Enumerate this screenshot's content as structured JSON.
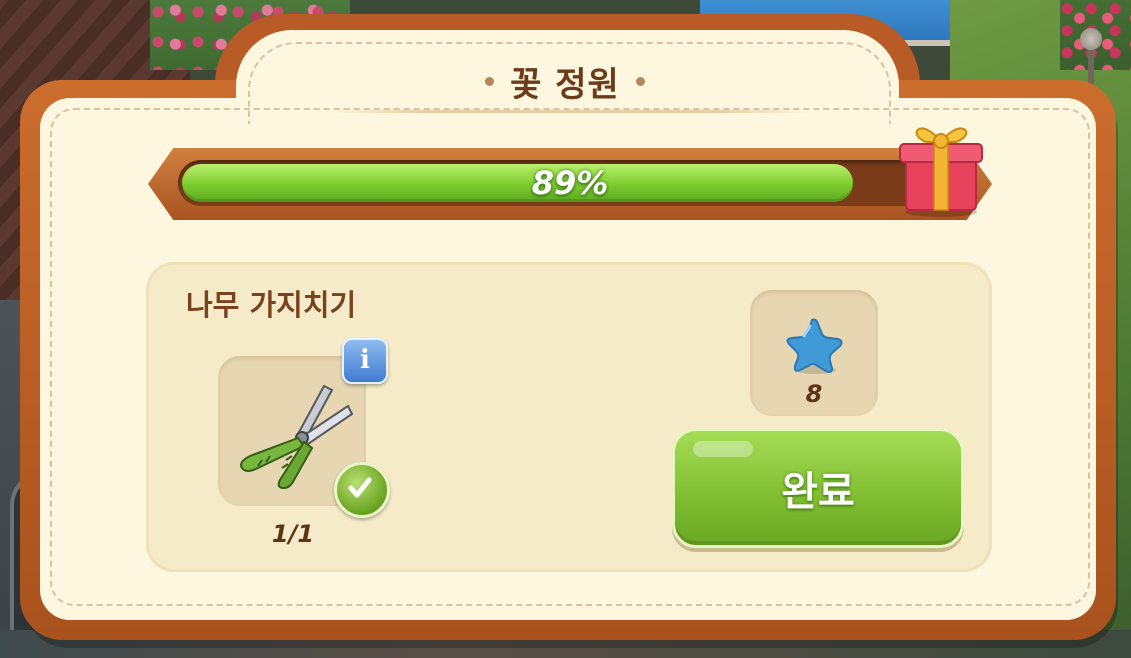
{
  "popup": {
    "title": "꽃 정원"
  },
  "progress": {
    "label": "89%",
    "value": 0.89,
    "fill_color": "#7ccc2e",
    "reward_icon": "gift-box-icon"
  },
  "task": {
    "title": "나무 가지치기",
    "required_item": {
      "icon": "pruning-shears-icon",
      "count_label": "1/1",
      "info_icon": "info-icon",
      "status_icon": "checkmark-icon"
    },
    "reward": {
      "icon": "blue-star-icon",
      "amount": "8",
      "color": "#3f9ad6"
    },
    "complete_button": {
      "label": "완료",
      "color": "#7fbd30"
    }
  }
}
